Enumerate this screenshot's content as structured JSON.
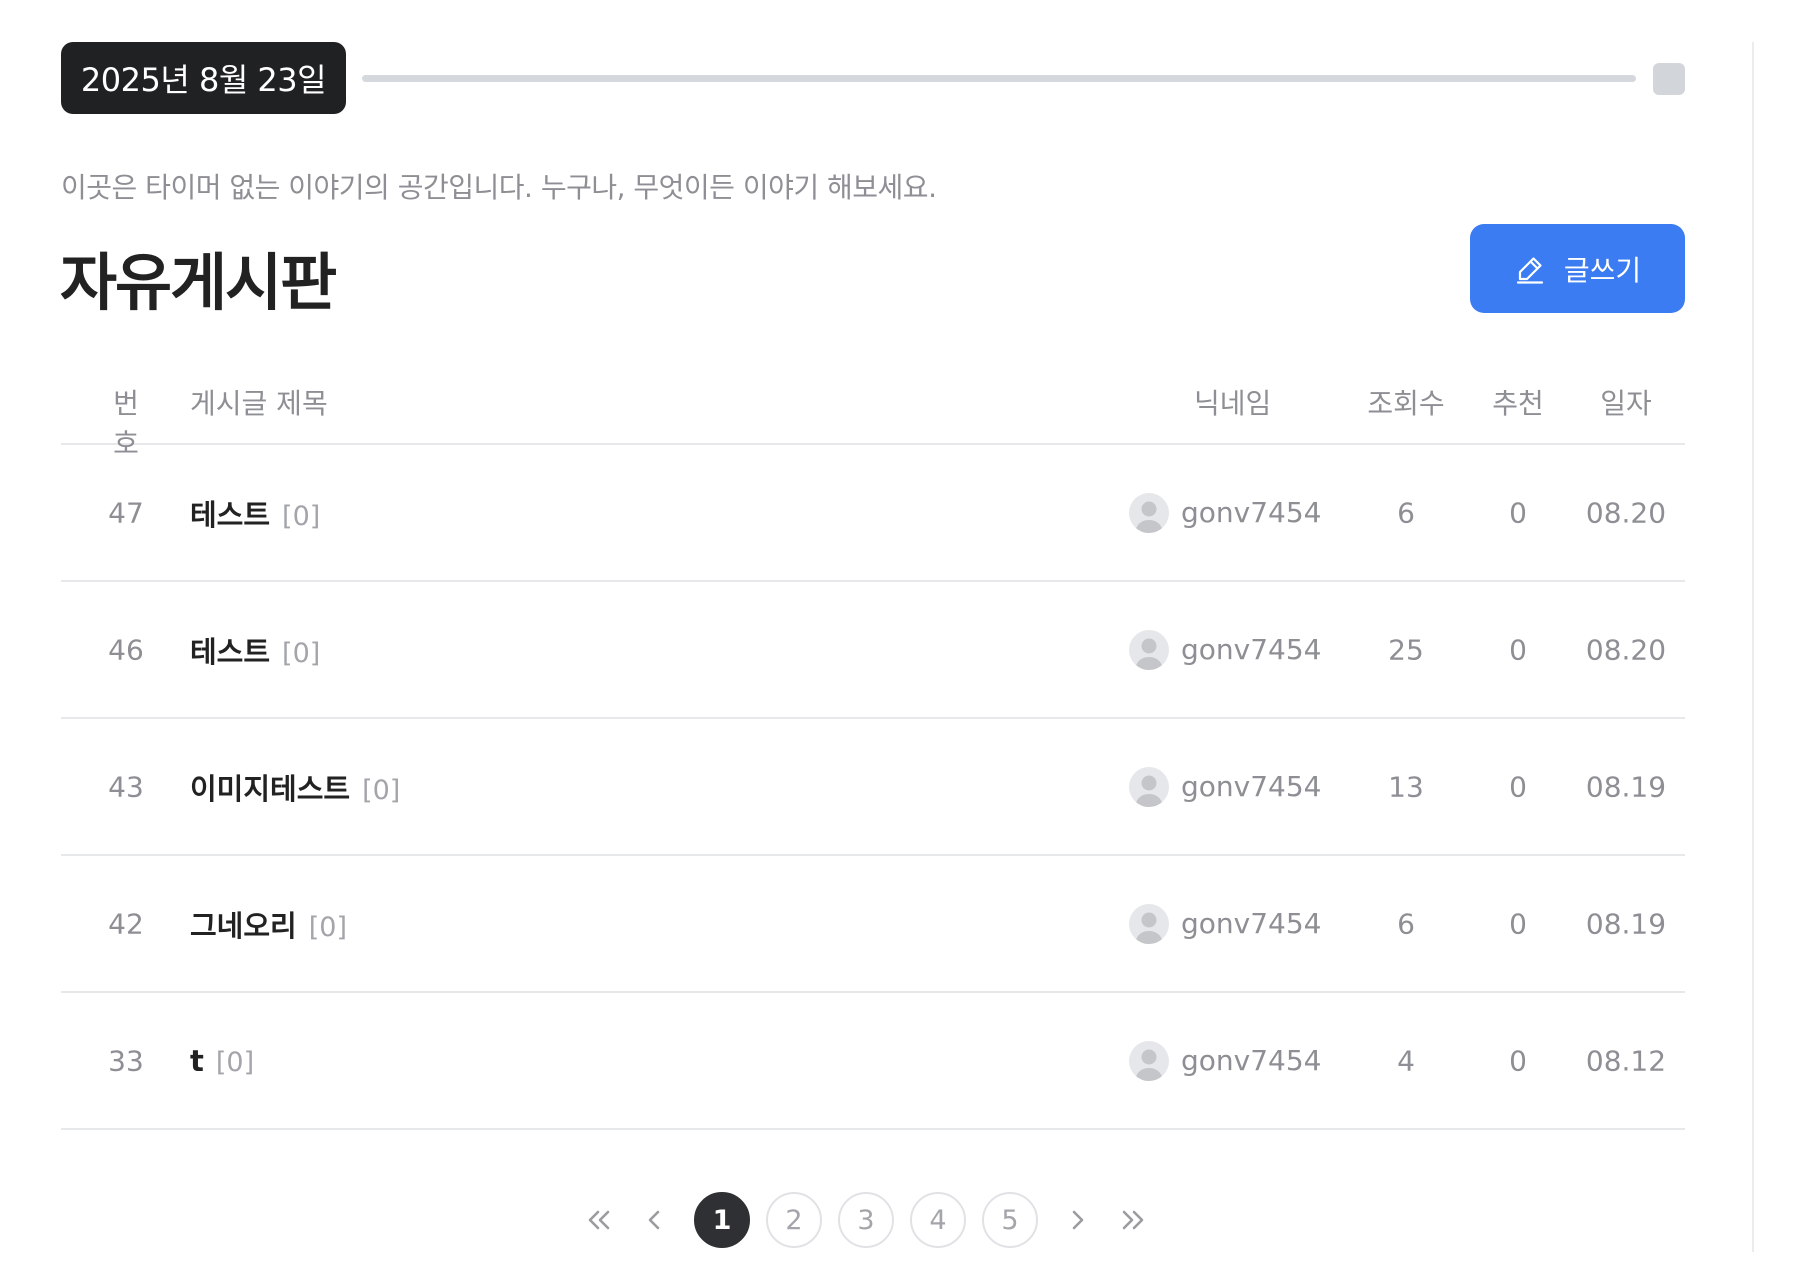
{
  "header": {
    "date": "2025년 8월 23일",
    "progress_percent": 0
  },
  "board": {
    "subtitle": "이곳은 타이머 없는 이야기의 공간입니다. 누구나, 무엇이든 이야기 해보세요.",
    "title": "자유게시판",
    "write_button_label": "글쓰기",
    "write_icon": "pencil-icon"
  },
  "table": {
    "columns": {
      "number": "번호",
      "title": "게시글 제목",
      "nickname": "닉네임",
      "views": "조회수",
      "recommend": "추천",
      "date": "일자"
    },
    "rows": [
      {
        "number": "47",
        "title": "테스트",
        "comments": "[0]",
        "nickname": "gonv7454",
        "views": "6",
        "recommend": "0",
        "date": "08.20"
      },
      {
        "number": "46",
        "title": "테스트",
        "comments": "[0]",
        "nickname": "gonv7454",
        "views": "25",
        "recommend": "0",
        "date": "08.20"
      },
      {
        "number": "43",
        "title": "이미지테스트",
        "comments": "[0]",
        "nickname": "gonv7454",
        "views": "13",
        "recommend": "0",
        "date": "08.19"
      },
      {
        "number": "42",
        "title": "그네오리",
        "comments": "[0]",
        "nickname": "gonv7454",
        "views": "6",
        "recommend": "0",
        "date": "08.19"
      },
      {
        "number": "33",
        "title": "t",
        "comments": "[0]",
        "nickname": "gonv7454",
        "views": "4",
        "recommend": "0",
        "date": "08.12"
      }
    ]
  },
  "pagination": {
    "pages": [
      "1",
      "2",
      "3",
      "4",
      "5"
    ],
    "current": "1"
  },
  "colors": {
    "accent": "#3b7cf2",
    "dark": "#1f2123",
    "muted": "#8d8f94"
  }
}
